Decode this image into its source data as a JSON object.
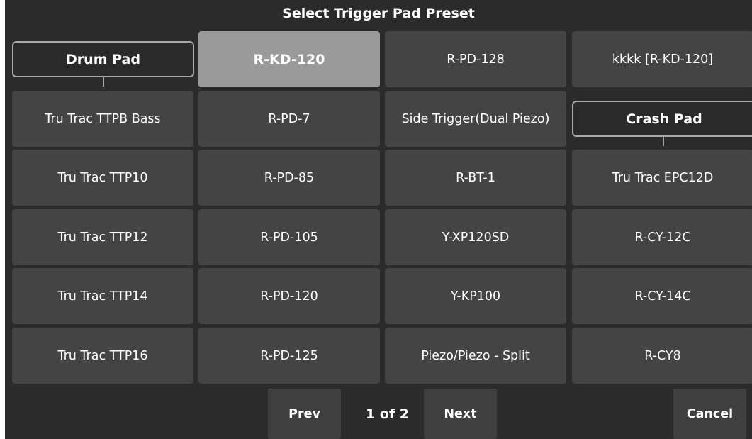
{
  "dialog": {
    "title": "Select Trigger Pad Preset"
  },
  "categories": {
    "drum_pad": "Drum Pad",
    "crash_pad": "Crash Pad"
  },
  "presets": {
    "r_kd_120": "R-KD-120",
    "r_pd_128": "R-PD-128",
    "kkkk_r_kd_120": "kkkk [R-KD-120]",
    "tru_trac_ttpb_bass": "Tru Trac TTPB Bass",
    "r_pd_7": "R-PD-7",
    "side_trigger_dual_piezo": "Side Trigger(Dual Piezo)",
    "tru_trac_ttp10": "Tru Trac TTP10",
    "r_pd_85": "R-PD-85",
    "r_bt_1": "R-BT-1",
    "tru_trac_epc12d": "Tru Trac EPC12D",
    "tru_trac_ttp12": "Tru Trac TTP12",
    "r_pd_105": "R-PD-105",
    "y_xp120sd": "Y-XP120SD",
    "r_cy_12c": "R-CY-12C",
    "tru_trac_ttp14": "Tru Trac TTP14",
    "r_pd_120": "R-PD-120",
    "y_kp100": "Y-KP100",
    "r_cy_14c": "R-CY-14C",
    "tru_trac_ttp16": "Tru Trac TTP16",
    "r_pd_125": "R-PD-125",
    "piezo_piezo_split": "Piezo/Piezo - Split",
    "r_cy8": "R-CY8"
  },
  "selected_preset": "R-KD-120",
  "pagination": {
    "prev_label": "Prev",
    "page_text": "1 of 2",
    "next_label": "Next"
  },
  "actions": {
    "cancel_label": "Cancel"
  },
  "colors": {
    "background": "#2b2b2b",
    "cell": "#444444",
    "selected": "#9a9a9a",
    "outline": "#a8a8a8"
  }
}
